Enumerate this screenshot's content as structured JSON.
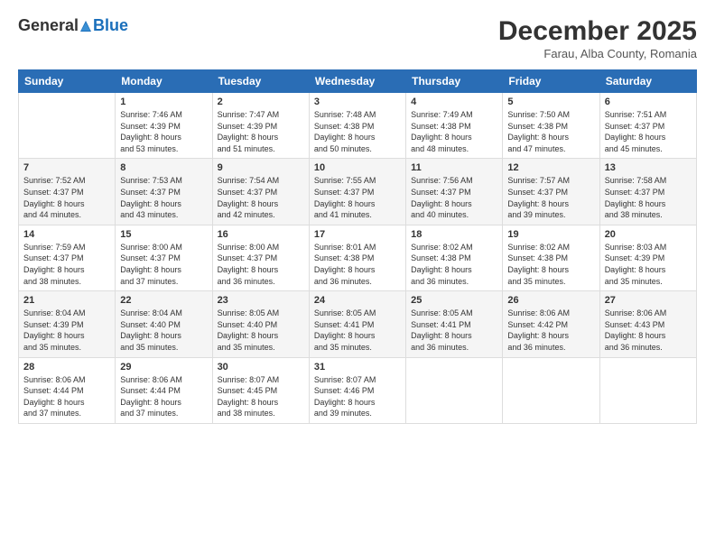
{
  "header": {
    "logo_general": "General",
    "logo_blue": "Blue",
    "month_title": "December 2025",
    "location": "Farau, Alba County, Romania"
  },
  "weekdays": [
    "Sunday",
    "Monday",
    "Tuesday",
    "Wednesday",
    "Thursday",
    "Friday",
    "Saturday"
  ],
  "weeks": [
    [
      {
        "day": "",
        "info": ""
      },
      {
        "day": "1",
        "info": "Sunrise: 7:46 AM\nSunset: 4:39 PM\nDaylight: 8 hours\nand 53 minutes."
      },
      {
        "day": "2",
        "info": "Sunrise: 7:47 AM\nSunset: 4:39 PM\nDaylight: 8 hours\nand 51 minutes."
      },
      {
        "day": "3",
        "info": "Sunrise: 7:48 AM\nSunset: 4:38 PM\nDaylight: 8 hours\nand 50 minutes."
      },
      {
        "day": "4",
        "info": "Sunrise: 7:49 AM\nSunset: 4:38 PM\nDaylight: 8 hours\nand 48 minutes."
      },
      {
        "day": "5",
        "info": "Sunrise: 7:50 AM\nSunset: 4:38 PM\nDaylight: 8 hours\nand 47 minutes."
      },
      {
        "day": "6",
        "info": "Sunrise: 7:51 AM\nSunset: 4:37 PM\nDaylight: 8 hours\nand 45 minutes."
      }
    ],
    [
      {
        "day": "7",
        "info": "Sunrise: 7:52 AM\nSunset: 4:37 PM\nDaylight: 8 hours\nand 44 minutes."
      },
      {
        "day": "8",
        "info": "Sunrise: 7:53 AM\nSunset: 4:37 PM\nDaylight: 8 hours\nand 43 minutes."
      },
      {
        "day": "9",
        "info": "Sunrise: 7:54 AM\nSunset: 4:37 PM\nDaylight: 8 hours\nand 42 minutes."
      },
      {
        "day": "10",
        "info": "Sunrise: 7:55 AM\nSunset: 4:37 PM\nDaylight: 8 hours\nand 41 minutes."
      },
      {
        "day": "11",
        "info": "Sunrise: 7:56 AM\nSunset: 4:37 PM\nDaylight: 8 hours\nand 40 minutes."
      },
      {
        "day": "12",
        "info": "Sunrise: 7:57 AM\nSunset: 4:37 PM\nDaylight: 8 hours\nand 39 minutes."
      },
      {
        "day": "13",
        "info": "Sunrise: 7:58 AM\nSunset: 4:37 PM\nDaylight: 8 hours\nand 38 minutes."
      }
    ],
    [
      {
        "day": "14",
        "info": "Sunrise: 7:59 AM\nSunset: 4:37 PM\nDaylight: 8 hours\nand 38 minutes."
      },
      {
        "day": "15",
        "info": "Sunrise: 8:00 AM\nSunset: 4:37 PM\nDaylight: 8 hours\nand 37 minutes."
      },
      {
        "day": "16",
        "info": "Sunrise: 8:00 AM\nSunset: 4:37 PM\nDaylight: 8 hours\nand 36 minutes."
      },
      {
        "day": "17",
        "info": "Sunrise: 8:01 AM\nSunset: 4:38 PM\nDaylight: 8 hours\nand 36 minutes."
      },
      {
        "day": "18",
        "info": "Sunrise: 8:02 AM\nSunset: 4:38 PM\nDaylight: 8 hours\nand 36 minutes."
      },
      {
        "day": "19",
        "info": "Sunrise: 8:02 AM\nSunset: 4:38 PM\nDaylight: 8 hours\nand 35 minutes."
      },
      {
        "day": "20",
        "info": "Sunrise: 8:03 AM\nSunset: 4:39 PM\nDaylight: 8 hours\nand 35 minutes."
      }
    ],
    [
      {
        "day": "21",
        "info": "Sunrise: 8:04 AM\nSunset: 4:39 PM\nDaylight: 8 hours\nand 35 minutes."
      },
      {
        "day": "22",
        "info": "Sunrise: 8:04 AM\nSunset: 4:40 PM\nDaylight: 8 hours\nand 35 minutes."
      },
      {
        "day": "23",
        "info": "Sunrise: 8:05 AM\nSunset: 4:40 PM\nDaylight: 8 hours\nand 35 minutes."
      },
      {
        "day": "24",
        "info": "Sunrise: 8:05 AM\nSunset: 4:41 PM\nDaylight: 8 hours\nand 35 minutes."
      },
      {
        "day": "25",
        "info": "Sunrise: 8:05 AM\nSunset: 4:41 PM\nDaylight: 8 hours\nand 36 minutes."
      },
      {
        "day": "26",
        "info": "Sunrise: 8:06 AM\nSunset: 4:42 PM\nDaylight: 8 hours\nand 36 minutes."
      },
      {
        "day": "27",
        "info": "Sunrise: 8:06 AM\nSunset: 4:43 PM\nDaylight: 8 hours\nand 36 minutes."
      }
    ],
    [
      {
        "day": "28",
        "info": "Sunrise: 8:06 AM\nSunset: 4:44 PM\nDaylight: 8 hours\nand 37 minutes."
      },
      {
        "day": "29",
        "info": "Sunrise: 8:06 AM\nSunset: 4:44 PM\nDaylight: 8 hours\nand 37 minutes."
      },
      {
        "day": "30",
        "info": "Sunrise: 8:07 AM\nSunset: 4:45 PM\nDaylight: 8 hours\nand 38 minutes."
      },
      {
        "day": "31",
        "info": "Sunrise: 8:07 AM\nSunset: 4:46 PM\nDaylight: 8 hours\nand 39 minutes."
      },
      {
        "day": "",
        "info": ""
      },
      {
        "day": "",
        "info": ""
      },
      {
        "day": "",
        "info": ""
      }
    ]
  ]
}
